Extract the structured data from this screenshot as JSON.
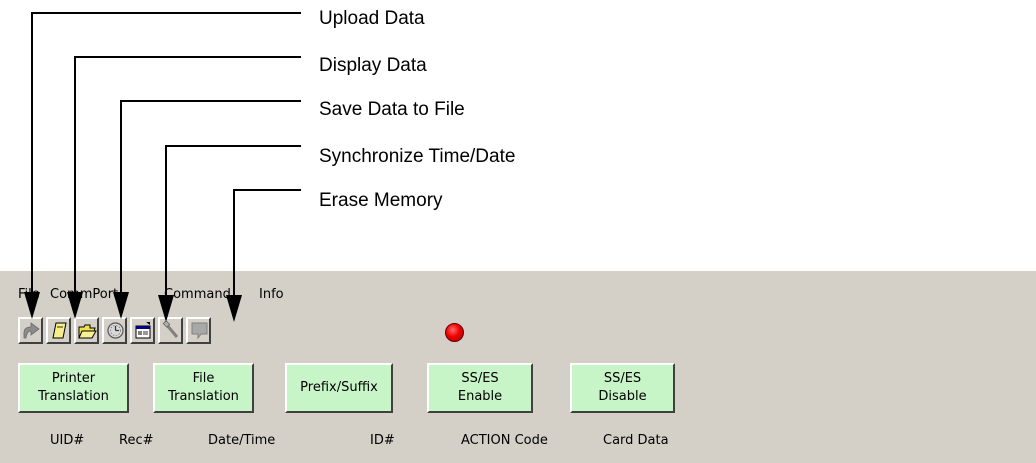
{
  "annotations": [
    {
      "label": "Upload Data",
      "target": "upload-data"
    },
    {
      "label": "Display Data",
      "target": "display-data"
    },
    {
      "label": "Save Data to File",
      "target": "save-data"
    },
    {
      "label": "Synchronize Time/Date",
      "target": "sync-time"
    },
    {
      "label": "Erase Memory",
      "target": "erase-memory"
    }
  ],
  "menubar": {
    "items": [
      "File",
      "CommPort",
      "Command",
      "Info"
    ]
  },
  "toolbar": {
    "icons": [
      "upload-arrow-icon",
      "document-icon",
      "open-folder-icon",
      "clock-icon",
      "properties-icon",
      "eraser-icon",
      "blank-page-icon"
    ]
  },
  "status": {
    "led_color": "#ee0000"
  },
  "buttons": {
    "printer_translation": {
      "line1": "Printer",
      "line2": "Translation"
    },
    "file_translation": {
      "line1": "File",
      "line2": "Translation"
    },
    "prefix_suffix": {
      "line1": "Prefix/Suffix"
    },
    "ss_es_enable": {
      "line1": "SS/ES",
      "line2": "Enable"
    },
    "ss_es_disable": {
      "line1": "SS/ES",
      "line2": "Disable"
    }
  },
  "columns": [
    "UID#",
    "Rec#",
    "Date/Time",
    "ID#",
    "ACTION Code",
    "Card Data"
  ],
  "colors": {
    "window_bg": "#d4d0c8",
    "button_green": "#c8f5c8"
  }
}
